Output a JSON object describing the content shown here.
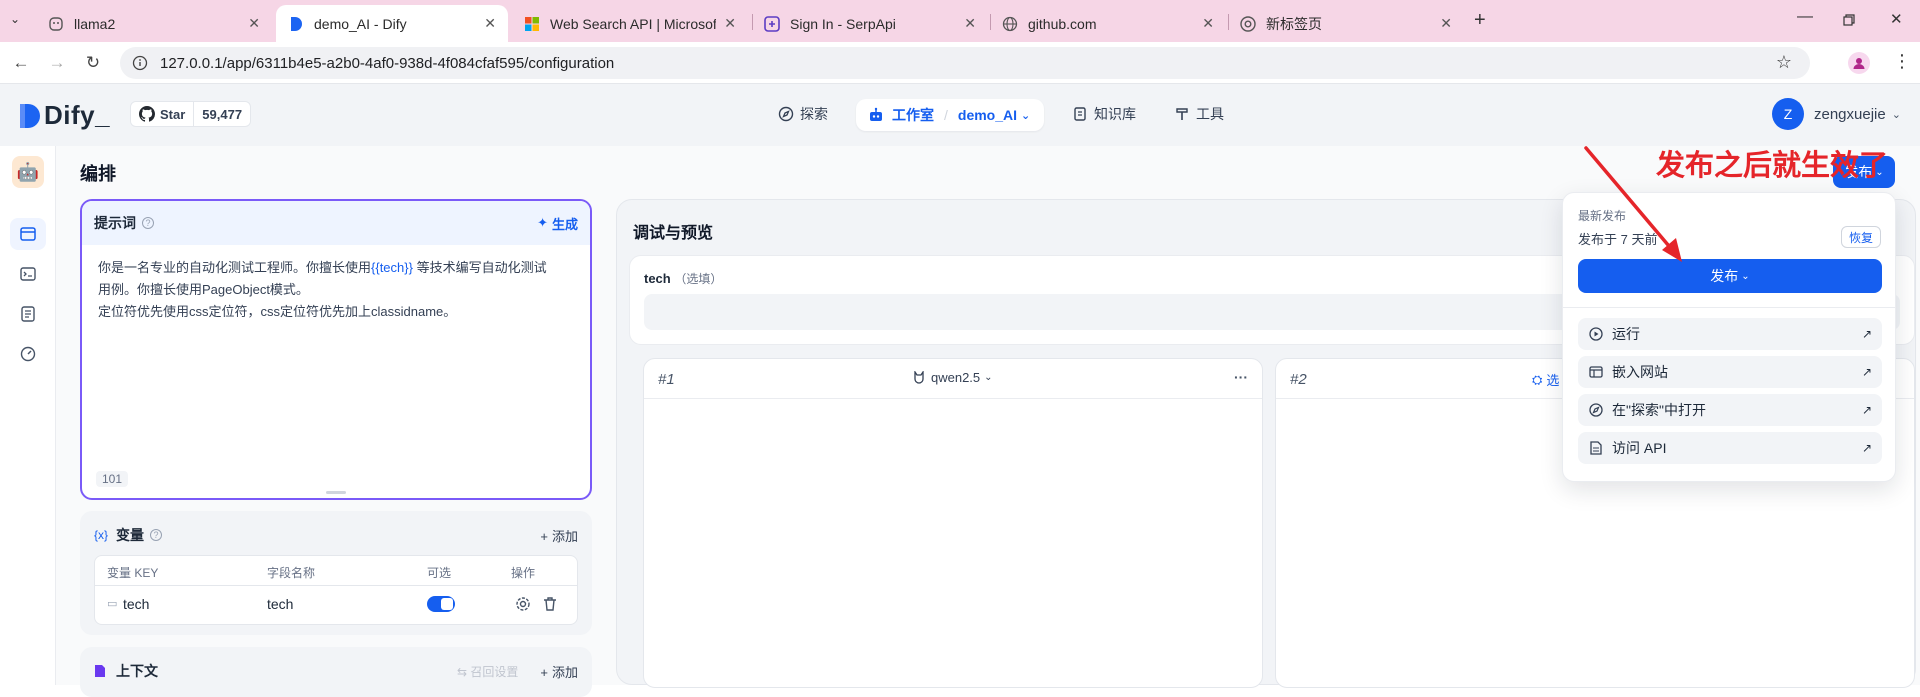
{
  "browser": {
    "tabs": [
      {
        "title": "llama2"
      },
      {
        "title": "demo_AI - Dify"
      },
      {
        "title": "Web Search API | Microsoft B"
      },
      {
        "title": "Sign In - SerpApi"
      },
      {
        "title": "github.com"
      },
      {
        "title": "新标签页"
      }
    ],
    "url": "127.0.0.1/app/6311b4e5-a2b0-4af0-938d-4f084cfaf595/configuration"
  },
  "header": {
    "logo_text": "Dify_",
    "github_star_label": "Star",
    "github_star_count": "59,477",
    "nav": {
      "explore": "探索",
      "studio": "工作室",
      "app_name": "demo_AI",
      "knowledge": "知识库",
      "tools": "工具"
    },
    "user": {
      "initial": "Z",
      "name": "zengxuejie"
    }
  },
  "page": {
    "title": "编排",
    "publish_button": "发布"
  },
  "prompt": {
    "title": "提示词",
    "generate_label": "生成",
    "text_line1_a": "你是一名专业的自动化测试工程师。你擅长使用",
    "text_line1_var": "{{tech}}",
    "text_line1_b": " 等技术编写自动化测试",
    "text_line2": "用例。你擅长使用PageObject模式。",
    "text_line3": "定位符优先使用css定位符，css定位符优先加上classidname。",
    "char_count": "101"
  },
  "variables": {
    "title": "变量",
    "add_label": "添加",
    "columns": [
      "变量 KEY",
      "字段名称",
      "可选",
      "操作"
    ],
    "rows": [
      {
        "key": "tech",
        "name": "tech",
        "optional": true
      }
    ]
  },
  "context": {
    "title": "上下文",
    "recall_label": "召回设置",
    "add_label": "添加"
  },
  "debug": {
    "title": "调试与预览",
    "input_label": "tech",
    "input_optional": "（选填）",
    "model1": {
      "index": "#1",
      "model_name": "qwen2.5",
      "more": "···"
    },
    "model2": {
      "index": "#2",
      "select_label": "选"
    }
  },
  "publish_popup": {
    "latest_label": "最新发布",
    "published_time": "发布于 7 天前",
    "restore_label": "恢复",
    "publish_button": "发布",
    "items": [
      {
        "label": "运行"
      },
      {
        "label": "嵌入网站"
      },
      {
        "label": "在\"探索\"中打开"
      },
      {
        "label": "访问 API"
      }
    ]
  },
  "annotation": {
    "text": "发布之后就生效了",
    "color": "#e5252a"
  },
  "colors": {
    "primary": "#155eef",
    "tab_bar": "#f6d6e6",
    "app_bg": "#f2f4f7"
  }
}
